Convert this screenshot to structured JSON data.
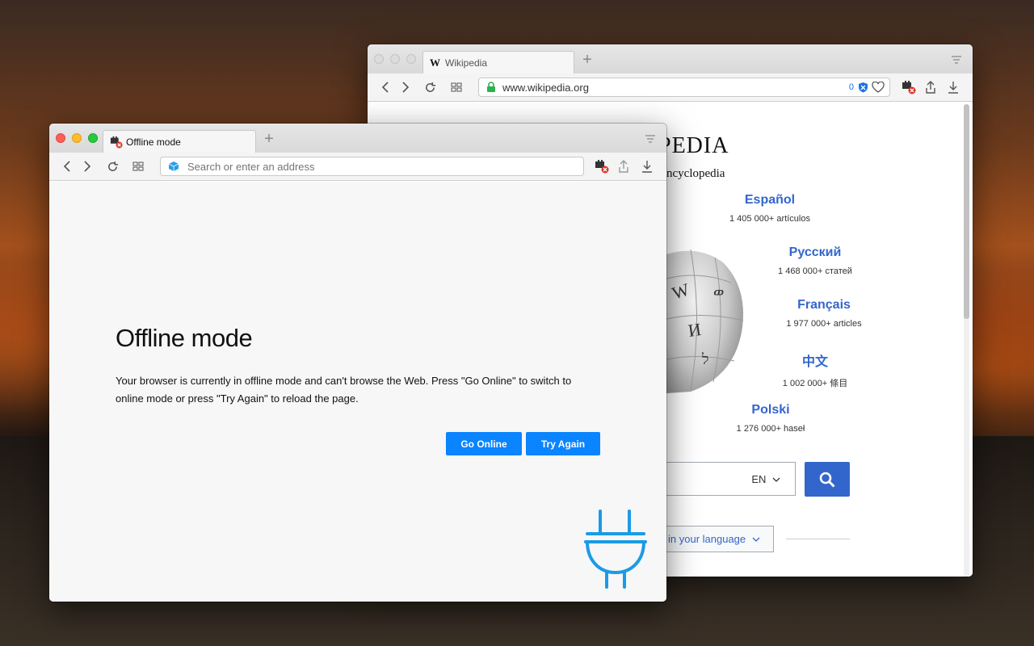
{
  "back_window": {
    "tab_title": "Wikipedia",
    "tab_favicon": "W",
    "address": "www.wikipedia.org",
    "tracker_count": "0",
    "page": {
      "wordmark_fragment": "PEDIA",
      "tagline_fragment": "ncyclopedia",
      "languages": [
        {
          "name": "Español",
          "count": "1 405 000+ artículos"
        },
        {
          "name": "Русский",
          "count": "1 468 000+ статей"
        },
        {
          "name": "Français",
          "count": "1 977 000+ articles"
        },
        {
          "name": "中文",
          "count": "1 002 000+ 條目"
        },
        {
          "name": "Polski",
          "count": "1 276 000+ haseł"
        }
      ],
      "search_lang": "EN",
      "read_language_fragment": "in your language"
    }
  },
  "front_window": {
    "tab_title": "Offline mode",
    "address_placeholder": "Search or enter an address",
    "page": {
      "title": "Offline mode",
      "message": "Your browser is currently in offline mode and can't browse the Web. Press \"Go Online\" to switch to online mode or press \"Try Again\" to reload the page.",
      "go_online_label": "Go Online",
      "try_again_label": "Try Again"
    }
  },
  "colors": {
    "accent": "#0a84ff",
    "plug": "#1a9be6",
    "wiki_link": "#3366cc",
    "lock_green": "#2bb24c"
  },
  "icons": [
    "back-icon",
    "forward-icon",
    "reload-icon",
    "grid-icon",
    "lock-icon",
    "tracker-shield-icon",
    "heart-icon",
    "offline-plug-icon",
    "share-icon",
    "download-icon",
    "tab-menu-icon",
    "search-icon",
    "plug-illustration"
  ]
}
